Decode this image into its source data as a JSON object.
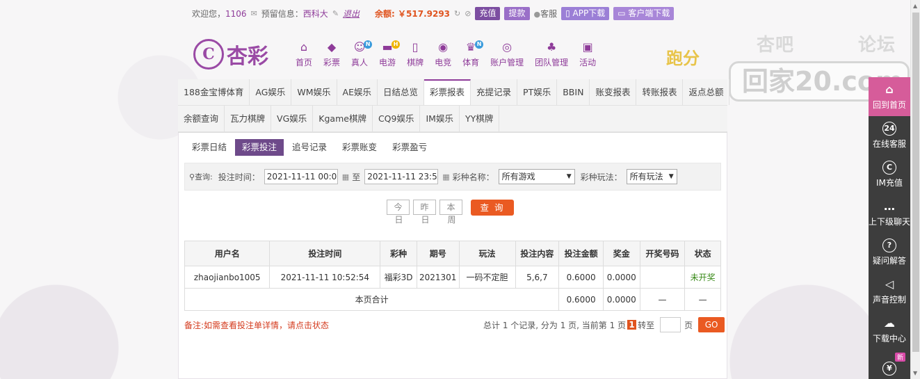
{
  "topbar": {
    "welcome": "欢迎您，",
    "user_no": "1106",
    "reserved_label": "预留信息：",
    "reserved_value": "西科大",
    "logout": "退出",
    "balance": "余额: ￥517.9293",
    "charge": "充值",
    "withdraw": "提款",
    "service": "客服",
    "app_download": "APP下载",
    "client_download": "客户端下载"
  },
  "logo": {
    "mark": "C",
    "text": "杏彩"
  },
  "nav": [
    {
      "label": "首页",
      "icon": "home-icon",
      "glyph": "⌂"
    },
    {
      "label": "彩票",
      "icon": "ticket-icon",
      "glyph": "◆"
    },
    {
      "label": "真人",
      "icon": "dealer-icon",
      "glyph": "☺",
      "badge": "N"
    },
    {
      "label": "电游",
      "icon": "gamepad-icon",
      "glyph": "▬",
      "badge": "H"
    },
    {
      "label": "棋牌",
      "icon": "cards-icon",
      "glyph": "▯"
    },
    {
      "label": "电竞",
      "icon": "esports-icon",
      "glyph": "◉"
    },
    {
      "label": "体育",
      "icon": "trophy-icon",
      "glyph": "♛",
      "badge": "N"
    },
    {
      "label": "账户管理",
      "icon": "account-icon",
      "glyph": "◎"
    },
    {
      "label": "团队管理",
      "icon": "team-icon",
      "glyph": "♣"
    },
    {
      "label": "活动",
      "icon": "gift-icon",
      "glyph": "▣"
    }
  ],
  "paofen": "跑分",
  "watermark": {
    "left": "杏吧",
    "right": "论坛",
    "box": "回家20.com"
  },
  "tabs_row1": [
    "188金宝博体育",
    "AG娱乐",
    "WM娱乐",
    "AE娱乐",
    "日结总览",
    "彩票报表",
    "充提记录",
    "PT娱乐",
    "BBIN",
    "账变报表",
    "转账报表",
    "返点总额"
  ],
  "tabs_row2": [
    "余额查询",
    "瓦力棋牌",
    "VG娱乐",
    "Kgame棋牌",
    "CQ9娱乐",
    "IM娱乐",
    "YY棋牌"
  ],
  "subtabs": [
    "彩票日结",
    "彩票投注",
    "追号记录",
    "彩票账变",
    "彩票盈亏"
  ],
  "query": {
    "prefix": "查询:",
    "time_label": "投注时间：",
    "start": "2021-11-11 00:00",
    "to": "至",
    "end": "2021-11-11 23:59",
    "type_label": "彩种名称：",
    "type_value": "所有游戏",
    "play_label": "彩种玩法：",
    "play_value": "所有玩法"
  },
  "quick": [
    {
      "top": "今",
      "bottom": "日"
    },
    {
      "top": "昨",
      "bottom": "日"
    },
    {
      "top": "本",
      "bottom": "周"
    }
  ],
  "search_btn": "查 询",
  "table": {
    "headers": [
      "用户名",
      "投注时间",
      "彩种",
      "期号",
      "玩法",
      "投注内容",
      "投注金额",
      "奖金",
      "开奖号码",
      "状态"
    ],
    "row": [
      "zhaojianbo1005",
      "2021-11-11 10:52:54",
      "福彩3D",
      "2021301",
      "一码不定胆",
      "5,6,7",
      "0.6000",
      "0.0000",
      "",
      "未开奖"
    ],
    "total": {
      "label": "本页合计",
      "amount": "0.6000",
      "bonus": "0.0000",
      "num": "—",
      "status": "—"
    }
  },
  "remark": "备注:如需查看投注单详情，请点击状态",
  "pager": {
    "summary": "总计 1 个记录, 分为 1 页, 当前第 1 页",
    "current": "1",
    "jump": "转至",
    "unit": "页",
    "go": "GO"
  },
  "sidebar": [
    {
      "label": "回到首页",
      "icon": "home-icon",
      "glyph": "⌂"
    },
    {
      "label": "在线客服",
      "icon": "support-icon",
      "glyph": "24"
    },
    {
      "label": "IM充值",
      "icon": "im-charge-icon",
      "glyph": "C"
    },
    {
      "label": "上下级聊天",
      "icon": "chat-icon",
      "glyph": "…"
    },
    {
      "label": "疑问解答",
      "icon": "question-icon",
      "glyph": "?"
    },
    {
      "label": "声音控制",
      "icon": "sound-icon",
      "glyph": "◁"
    },
    {
      "label": "下载中心",
      "icon": "download-icon",
      "glyph": "☁"
    },
    {
      "label": "",
      "icon": "money-bag-icon",
      "glyph": "¥",
      "tag": "新"
    }
  ],
  "colors": {
    "brand": "#8e3b99",
    "accent": "#ea5a22",
    "sidebar_home": "#d65c9a"
  }
}
